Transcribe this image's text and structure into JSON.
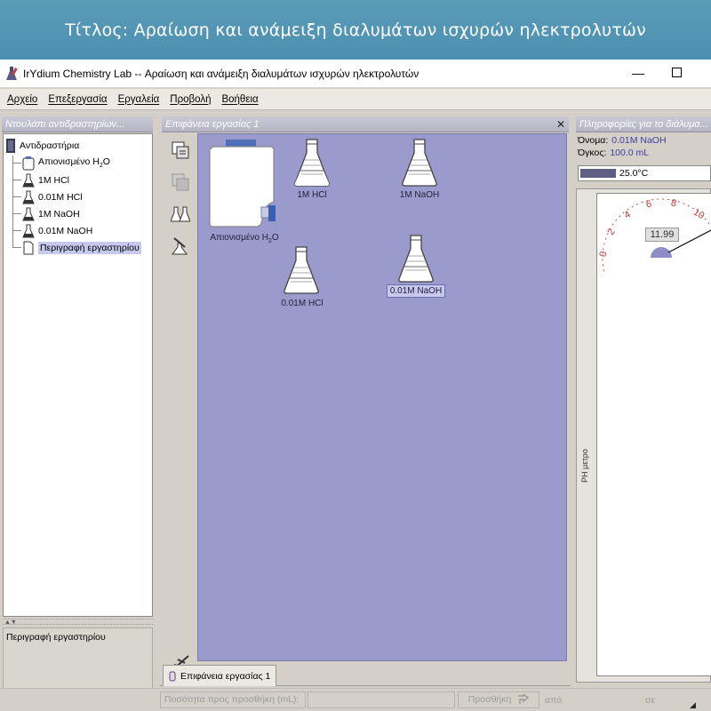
{
  "banner": {
    "title": "Τίτλος:  Αραίωση και ανάμειξη διαλυμάτων ισχυρών ηλεκτρολυτών"
  },
  "window": {
    "title": "IrYdium Chemistry Lab -- Αραίωση και ανάμειξη διαλυμάτων ισχυρών ηλεκτρολυτών"
  },
  "menu": [
    "Αρχείο",
    "Επεξεργασία",
    "Εργαλεία",
    "Προβολή",
    "Βοήθεια"
  ],
  "left_panel": {
    "header": "Ντουλάπι αντιδραστηρίων...",
    "root": "Αντιδραστήρια",
    "items": [
      {
        "label": "Απιονισμένο H",
        "sub": "2",
        "tail": "O",
        "icon": "water-bottle-icon"
      },
      {
        "label": "1M HCl",
        "icon": "flask-icon"
      },
      {
        "label": "0.01M HCl",
        "icon": "flask-icon"
      },
      {
        "label": "1M NaOH",
        "icon": "flask-icon"
      },
      {
        "label": "0.01M NaOH",
        "icon": "flask-icon"
      },
      {
        "label": "Περιγραφή εργαστηρίου",
        "icon": "document-icon",
        "selected": true
      }
    ],
    "description_title": "Περιγραφή εργαστηρίου"
  },
  "workspace": {
    "header": "Επιφάνεια εργασίας 1",
    "tab": "Επιφάνεια εργασίας 1",
    "canvas_color": "#9a9acd",
    "objects": [
      {
        "label_pre": "Απιονισμένο H",
        "sub": "2",
        "label_post": "O",
        "kind": "water-carboy"
      },
      {
        "label": "1M HCl",
        "kind": "flask"
      },
      {
        "label": "1M NaOH",
        "kind": "flask"
      },
      {
        "label": "0.01M HCl",
        "kind": "flask"
      },
      {
        "label": "0.01M NaOH",
        "kind": "flask",
        "selected": true
      }
    ]
  },
  "info_panel": {
    "header": "Πληροφορίες για το διάλυμα...",
    "name_label": "Όνομα:",
    "name_value": "0.01M NaOH",
    "volume_label": "Όγκος:",
    "volume_value": "100.0 mL",
    "temperature": "25.0°C",
    "ph_meter_label": "PH μετρο",
    "ph_value": "11.99",
    "ph_ticks": [
      "0",
      "2",
      "4",
      "6",
      "8",
      "10"
    ]
  },
  "bottom_bar": {
    "quantity_label": "Ποσότητα προς προσθήκη (mL):",
    "quantity_value": "",
    "add_button": "Προσθήκη",
    "from_label": "από",
    "to_label": "σε"
  }
}
